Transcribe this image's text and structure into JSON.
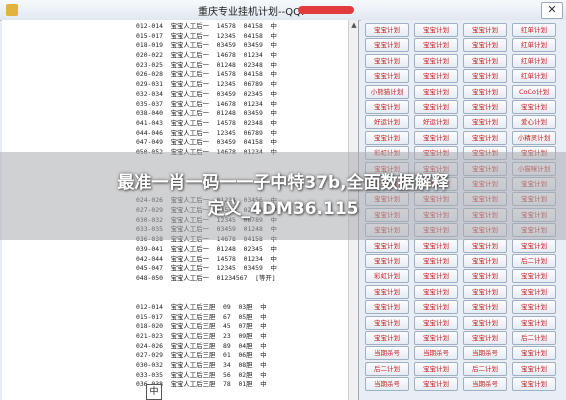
{
  "window": {
    "title": "重庆专业挂机计划--QQ:",
    "close_glyph": "✕"
  },
  "text_panel": {
    "lines": [
      "012-014  宝宝人工后一  14578  04158  中",
      "015-017  宝宝人工后一  12345  04158  中",
      "018-019  宝宝人工后一  03459  03459  中",
      "020-022  宝宝人工后一  14678  01234  中",
      "023-025  宝宝人工后一  01248  02348  中",
      "026-028  宝宝人工后一  14578  04158  中",
      "029-031  宝宝人工后一  12345  06789  中",
      "032-034  宝宝人工后一  03459  02345  中",
      "035-037  宝宝人工后一  14678  01234  中",
      "038-040  宝宝人工后一  01248  03459  中",
      "041-043  宝宝人工后一  14578  02348  中",
      "044-046  宝宝人工后一  12345  06789  中",
      "047-049  宝宝人工后一  03459  04158  中",
      "050-052  宝宝人工后一  14678  01234  中",
      "",
      "",
      "",
      "",
      "024-026  宝宝人工后一  01234  03456  中",
      "027-029  宝宝人工后一  04578  02348  中",
      "030-032  宝宝人工后一  12345  06789  中",
      "033-035  宝宝人工后一  03459  01248  中",
      "036-038  宝宝人工后一  14678  04158  中",
      "039-041  宝宝人工后一  01248  02345  中",
      "042-044  宝宝人工后一  14578  01234  中",
      "045-047  宝宝人工后一  12345  03459  中",
      "048-050  宝宝人工后一  01234567  [等开]",
      "",
      "",
      "012-014  宝宝人工后三胆  09  03胆  中",
      "015-017  宝宝人工后三胆  67  05胆  中",
      "018-020  宝宝人工后三胆  45  07胆  中",
      "021-023  宝宝人工后三胆  23  09胆  中",
      "024-026  宝宝人工后三胆  89  04胆  中",
      "027-029  宝宝人工后三胆  01  06胆  中",
      "030-032  宝宝人工后三胆  34  08胆  中",
      "033-035  宝宝人工后三胆  56  02胆  中",
      "036-038  宝宝人工后三胆  78  01胆  中"
    ],
    "bottom_box": "中"
  },
  "buttons": [
    [
      "宝宝计划",
      "宝宝计划",
      "宝宝计划",
      "红单计划"
    ],
    [
      "宝宝计划",
      "宝宝计划",
      "宝宝计划",
      "红单计划"
    ],
    [
      "宝宝计划",
      "宝宝计划",
      "宝宝计划",
      "红单计划"
    ],
    [
      "宝宝计划",
      "宝宝计划",
      "宝宝计划",
      "红单计划"
    ],
    [
      "小熊猫计划",
      "宝宝计划",
      "宝宝计划",
      "CoCo计划"
    ],
    [
      "宝宝计划",
      "宝宝计划",
      "宝宝计划",
      "宝宝计划"
    ],
    [
      "好运计划",
      "好运计划",
      "宝宝计划",
      "爱心计划"
    ],
    [
      "宝宝计划",
      "宝宝计划",
      "宝宝计划",
      "小精灵计划"
    ],
    [
      "彩虹计划",
      "宝宝计划",
      "宝宝计划",
      "宝宝计划"
    ],
    [
      "宝宝计划",
      "宝宝计划",
      "宝宝计划",
      "小猫咪计划"
    ],
    [
      "宝宝计划",
      "全面计划",
      "宝宝计划",
      "宝宝计划"
    ],
    [
      "宝宝计划",
      "宝宝计划",
      "宝宝计划",
      "宝宝计划"
    ],
    [
      "宝宝计划",
      "宝宝计划",
      "宝宝计划",
      "宝宝计划"
    ],
    [
      "宝宝计划",
      "宝宝计划",
      "宝宝计划",
      "宝宝计划"
    ],
    [
      "宝宝计划",
      "宝宝计划",
      "宝宝计划",
      "宝宝计划"
    ],
    [
      "宝宝计划",
      "宝宝计划",
      "宝宝计划",
      "后二计划"
    ],
    [
      "彩虹计划",
      "宝宝计划",
      "宝宝计划",
      "宝宝计划"
    ],
    [
      "宝宝计划",
      "宝宝计划",
      "宝宝计划",
      "宝宝计划"
    ],
    [
      "宝宝计划",
      "宝宝计划",
      "宝宝计划",
      "宝宝计划"
    ],
    [
      "宝宝计划",
      "宝宝计划",
      "宝宝计划",
      "宝宝计划"
    ],
    [
      "宝宝计划",
      "宝宝计划",
      "宝宝计划",
      "后二计划"
    ],
    [
      "当期杀号",
      "当期杀号",
      "当期杀号",
      "宝宝计划"
    ],
    [
      "后二计划",
      "宝宝计划",
      "后二计划",
      "宝宝计划"
    ],
    [
      "当期杀号",
      "宝宝计划",
      "当期杀号",
      "宝宝计划"
    ]
  ],
  "overlay": {
    "line1": "最准一肖一码一一子中特37b,全面数据解释",
    "line2": "定义_4DM36.115"
  },
  "colors": {
    "button_text": "#c82020",
    "overlay_band": "#aaacaf",
    "redaction": "#e23b3b"
  }
}
